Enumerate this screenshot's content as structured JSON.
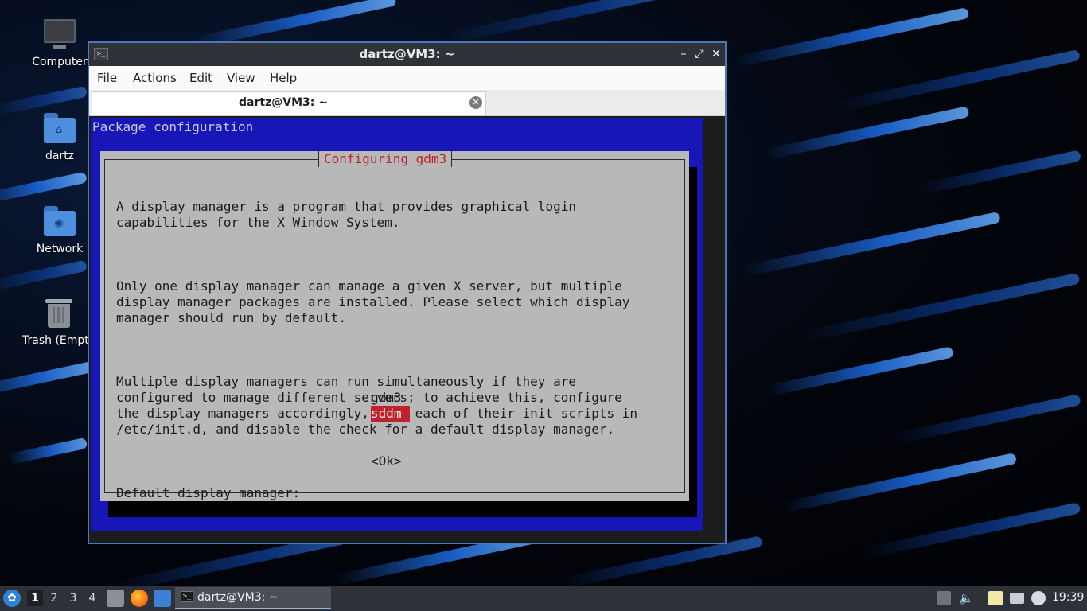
{
  "colors": {
    "terminal_blue": "#1717b8",
    "dialog_gray": "#b8b8b8",
    "accent_red": "#c0222b",
    "taskbar": "#2e3238",
    "titlebar": "#2f3339"
  },
  "desktop": {
    "icons": [
      {
        "label": "Computer",
        "icon": "computer-icon"
      },
      {
        "label": "dartz",
        "icon": "home-folder-icon"
      },
      {
        "label": "Network",
        "icon": "network-folder-icon"
      },
      {
        "label": "Trash (Empty)",
        "icon": "trash-icon"
      }
    ]
  },
  "window": {
    "app_icon": "terminal-icon",
    "title": "dartz@VM3: ~",
    "controls": {
      "minimize": "–",
      "maximize": "⤢",
      "close": "✕"
    },
    "menu": [
      "File",
      "Actions",
      "Edit",
      "View",
      "Help"
    ],
    "tab": {
      "label": "dartz@VM3: ~",
      "close": "✕"
    }
  },
  "terminal": {
    "header": "Package configuration",
    "dialog": {
      "title": "Configuring gdm3",
      "paragraphs": [
        "A display manager is a program that provides graphical login\ncapabilities for the X Window System.",
        "Only one display manager can manage a given X server, but multiple\ndisplay manager packages are installed. Please select which display\nmanager should run by default.",
        "Multiple display managers can run simultaneously if they are\nconfigured to manage different servers; to achieve this, configure\nthe display managers accordingly, edit each of their init scripts in\n/etc/init.d, and disable the check for a default display manager.",
        "Default display manager:"
      ],
      "options": [
        {
          "label": "gdm3",
          "selected": false
        },
        {
          "label": "sddm",
          "selected": true
        }
      ],
      "ok": "<Ok>"
    }
  },
  "taskbar": {
    "start_icon": "lubuntu-logo-icon",
    "workspaces": [
      "1",
      "2",
      "3",
      "4"
    ],
    "active_workspace": "1",
    "launchers": [
      "file-manager-icon",
      "firefox-icon",
      "show-desktop-icon"
    ],
    "task": {
      "label": "dartz@VM3: ~",
      "icon": "terminal-icon"
    },
    "tray": [
      "update-notifier-icon",
      "volume-icon",
      "clipboard-icon",
      "network-icon",
      "notification-icon"
    ],
    "clock": "19:39"
  }
}
